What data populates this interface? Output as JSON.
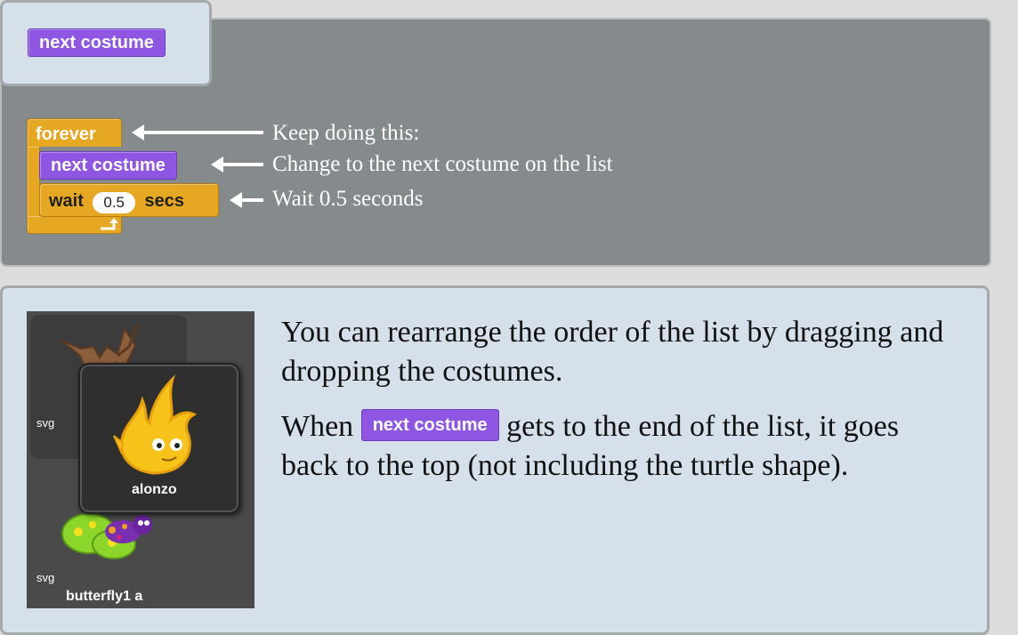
{
  "palette_block": "next costume",
  "script": {
    "forever": "forever",
    "next_costume": "next costume",
    "wait": "wait",
    "wait_value": "0.5",
    "secs": "secs"
  },
  "annotations": {
    "forever": "Keep doing this:",
    "next_costume": "Change to the next costume on the list",
    "wait": "Wait 0.5 seconds"
  },
  "costumes": {
    "top_label": "svg",
    "dragged_name": "alonzo",
    "bottom_label": "svg",
    "bottom_name": "butterfly1 a"
  },
  "text": {
    "para1": "You can rearrange the order of the list by dragging and dropping the costumes.",
    "para2_before": "When",
    "para2_block": "next costume",
    "para2_after": "gets to the end of the list, it goes back to the top (not including the turtle shape)."
  },
  "colors": {
    "motion_purple": "#8f56e3",
    "control_orange": "#e6a822",
    "scripts_gray": "#858a8d",
    "note_blue": "#d6e0ea"
  }
}
